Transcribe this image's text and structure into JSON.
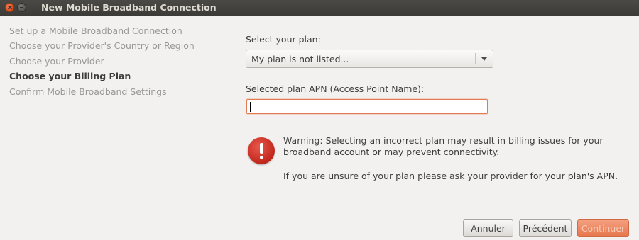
{
  "window": {
    "title": "New Mobile Broadband Connection"
  },
  "sidebar": {
    "steps": [
      {
        "label": "Set up a Mobile Broadband Connection",
        "active": false
      },
      {
        "label": "Choose your Provider's Country or Region",
        "active": false
      },
      {
        "label": "Choose your Provider",
        "active": false
      },
      {
        "label": "Choose your Billing Plan",
        "active": true
      },
      {
        "label": "Confirm Mobile Broadband Settings",
        "active": false
      }
    ]
  },
  "main": {
    "plan_label": "Select your plan:",
    "plan_selected": "My plan is not listed...",
    "apn_label": "Selected plan APN (Access Point Name):",
    "apn_value": "",
    "warning_text": "Warning: Selecting an incorrect plan may result in billing issues for your broadband account or may prevent connectivity.",
    "info_text": "If you are unsure of your plan please ask your provider for your plan's APN."
  },
  "buttons": {
    "cancel": "Annuler",
    "back": "Précédent",
    "next": "Continuer"
  },
  "colors": {
    "titlebar": "#3c3b37",
    "accent": "#e7764c",
    "warning_icon": "#c1271d"
  },
  "icons": {
    "close": "close-icon",
    "minimize": "minimize-icon",
    "dropdown": "chevron-down-icon",
    "warning": "error-icon"
  }
}
